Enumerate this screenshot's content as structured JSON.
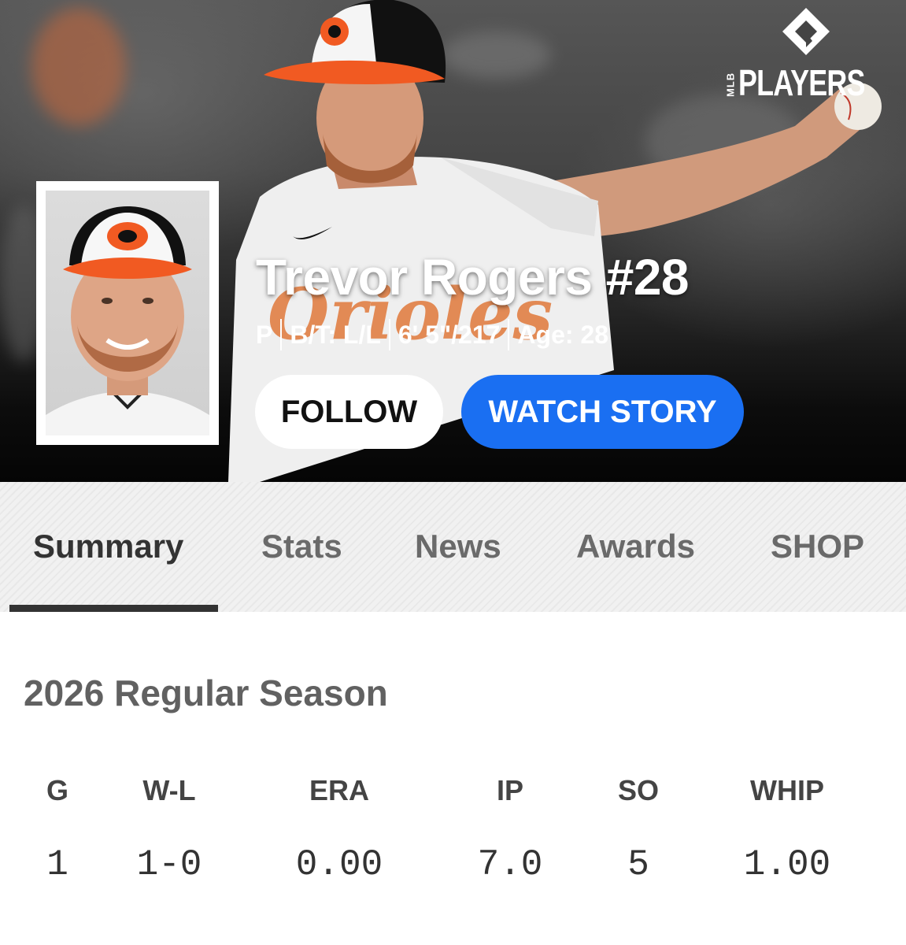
{
  "brand": {
    "org": "MLB",
    "name": "PLAYERS"
  },
  "player": {
    "name": "Trevor Rogers #28",
    "position": "P",
    "bats_throws": "B/T: L/L",
    "height_weight": "6' 5\"/217",
    "age": "Age: 28",
    "jersey_text": "Orioles"
  },
  "actions": {
    "follow": "FOLLOW",
    "watch_story": "WATCH STORY"
  },
  "tabs": [
    {
      "label": "Summary",
      "active": true
    },
    {
      "label": "Stats",
      "active": false
    },
    {
      "label": "News",
      "active": false
    },
    {
      "label": "Awards",
      "active": false
    },
    {
      "label": "SHOP",
      "active": false
    }
  ],
  "season": {
    "title": "2026 Regular Season",
    "columns": [
      "G",
      "W-L",
      "ERA",
      "IP",
      "SO",
      "WHIP"
    ],
    "values": [
      "1",
      "1-0",
      "0.00",
      "7.0",
      "5",
      "1.00"
    ]
  },
  "colors": {
    "accent_blue": "#1a6ff2",
    "orioles_orange": "#f15a22",
    "tab_underline": "#333333"
  }
}
